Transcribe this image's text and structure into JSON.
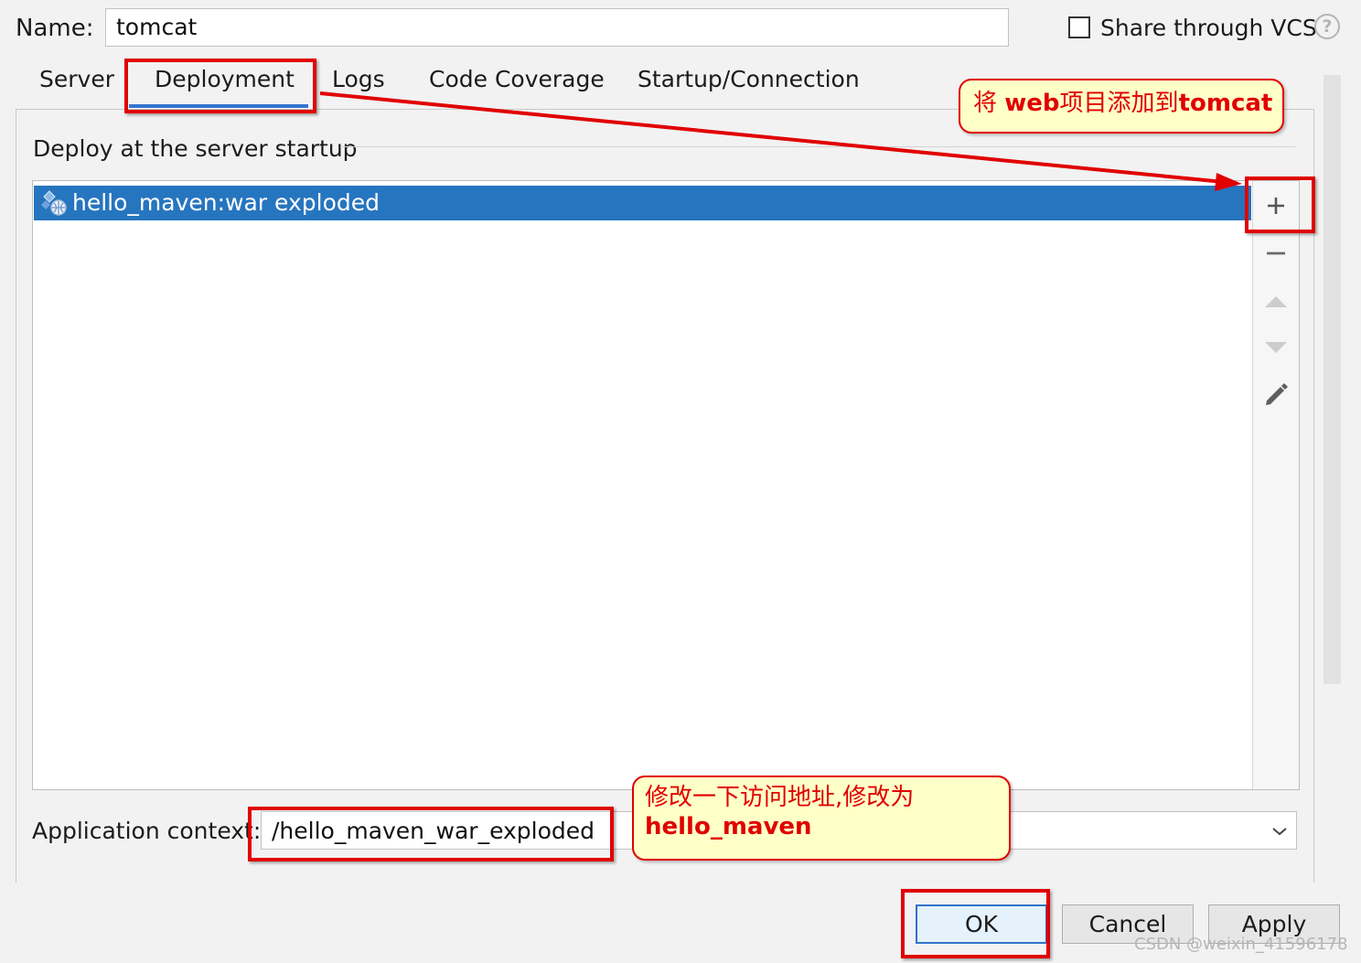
{
  "header": {
    "name_label": "Name:",
    "name_value": "tomcat",
    "share_label": "Share through VCS",
    "help_glyph": "?"
  },
  "tabs": [
    {
      "label": "Server"
    },
    {
      "label": "Deployment"
    },
    {
      "label": "Logs"
    },
    {
      "label": "Code Coverage"
    },
    {
      "label": "Startup/Connection"
    }
  ],
  "deployment": {
    "heading": "Deploy at the server startup",
    "items": [
      {
        "label": "hello_maven:war exploded",
        "icon": "artifact-icon"
      }
    ],
    "toolbar": [
      "add-icon",
      "remove-icon",
      "move-up-icon",
      "move-down-icon",
      "edit-icon"
    ]
  },
  "context": {
    "label": "Application context:",
    "value": "/hello_maven_war_exploded"
  },
  "buttons": {
    "ok": "OK",
    "cancel": "Cancel",
    "apply": "Apply"
  },
  "annotations": {
    "add_prefix": "将",
    "add_web": "web",
    "add_middle": "项目添加到",
    "add_tomcat": "tomcat",
    "context_line1": "修改一下访问地址,修改为",
    "context_line2": "hello_maven"
  },
  "watermark": "CSDN @weixin_41596178",
  "colors": {
    "selection": "#2675bf",
    "annotation_red": "#e00000",
    "callout_fill": "#ffffc8"
  }
}
